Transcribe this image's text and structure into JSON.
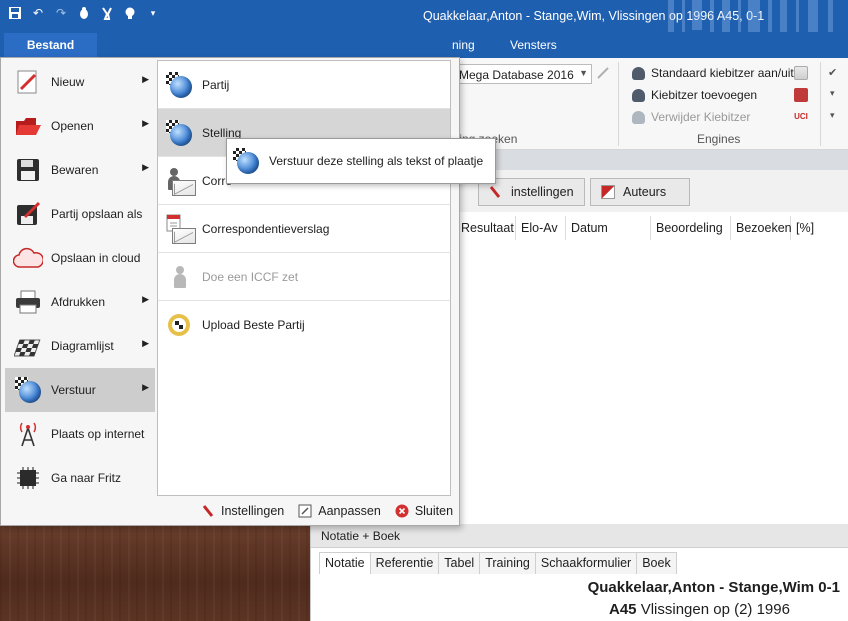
{
  "window": {
    "title": "Quakkelaar,Anton - Stange,Wim, Vlissingen op 1996  A45, 0-1",
    "quick_access_icons": [
      "save-icon",
      "undo-icon",
      "redo-icon",
      "bug-icon",
      "tools-icon",
      "bulb-icon",
      "dropdown-icon"
    ]
  },
  "ribbon": {
    "file_tab": "Bestand",
    "tabs": [
      "ning",
      "Vensters"
    ],
    "database_combo": "Mega Database 2016",
    "group_label_database": "lling zoeken",
    "engines": {
      "items": [
        {
          "label": "Standaard kiebitzer aan/uit",
          "enabled": true
        },
        {
          "label": "Kiebitzer toevoegen",
          "enabled": true
        },
        {
          "label": "Verwijder Kiebitzer",
          "enabled": false
        }
      ],
      "group_label": "Engines",
      "uci_badge": "UCI"
    }
  },
  "toolbar2": {
    "settings_button": "instellingen",
    "authors_button": "Auteurs"
  },
  "grid": {
    "columns": [
      "Resultaat",
      "Elo-Av",
      "Datum",
      "Beoordeling",
      "Bezoeken",
      "[%]"
    ]
  },
  "file_menu": {
    "left_items": [
      {
        "label": "Nieuw",
        "icon": "new-icon",
        "submenu": true
      },
      {
        "label": "Openen",
        "icon": "folder-open-icon",
        "submenu": true
      },
      {
        "label": "Bewaren",
        "icon": "floppy-icon",
        "submenu": true
      },
      {
        "label": "Partij opslaan als",
        "icon": "save-as-icon",
        "submenu": false
      },
      {
        "label": "Opslaan in cloud",
        "icon": "cloud-icon",
        "submenu": false
      },
      {
        "label": "Afdrukken",
        "icon": "printer-icon",
        "submenu": true
      },
      {
        "label": "Diagramlijst",
        "icon": "chessboard-icon",
        "submenu": true
      },
      {
        "label": "Verstuur",
        "icon": "globe-send-icon",
        "submenu": true,
        "selected": true
      },
      {
        "label": "Plaats op internet",
        "icon": "antenna-icon",
        "submenu": false
      },
      {
        "label": "Ga naar Fritz",
        "icon": "chip-icon",
        "submenu": false
      }
    ],
    "sub_items": [
      {
        "label": "Partij",
        "icon": "globe-board-icon",
        "enabled": true
      },
      {
        "label": "Stelling",
        "icon": "globe-board-icon",
        "enabled": true,
        "hovered": true
      },
      {
        "label": "Corre",
        "icon": "pawn-mail-icon",
        "enabled": true
      },
      {
        "label": "Correspondentieverslag",
        "icon": "report-mail-icon",
        "enabled": true
      },
      {
        "label": "Doe een ICCF zet",
        "icon": "pawn-icon",
        "enabled": false
      },
      {
        "label": "Upload Beste Partij",
        "icon": "trophy-board-icon",
        "enabled": true
      }
    ],
    "flyout": "Verstuur deze stelling als tekst of plaatje",
    "footer": {
      "settings": "Instellingen",
      "customize": "Aanpassen",
      "close": "Sluiten"
    }
  },
  "notation_panel": {
    "header": "Notatie + Boek",
    "tabs": [
      "Notatie",
      "Referentie",
      "Tabel",
      "Training",
      "Schaakformulier",
      "Boek"
    ],
    "active_tab": "Notatie",
    "players": "Quakkelaar,Anton - Stange,Wim  0-1",
    "eco": "A45",
    "event": "Vlissingen op (2) 1996"
  },
  "colors": {
    "titlebar": "#1f5fb0",
    "file_tab": "#2b6cc4",
    "selected_item": "#cdcdcd"
  }
}
